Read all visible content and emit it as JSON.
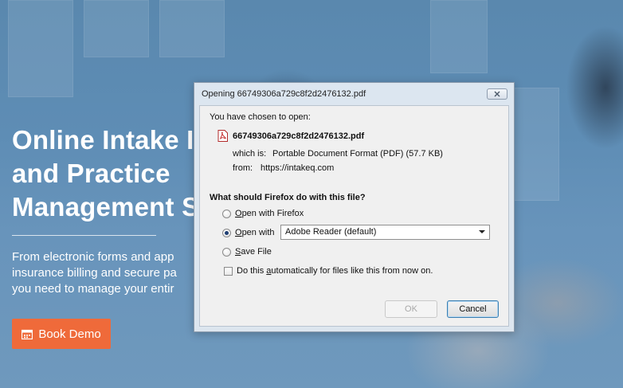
{
  "hero": {
    "headline": "Online Intake I\nand Practice\nManagement S",
    "subtext": "From electronic forms and app\ninsurance billing and secure pa\nyou need to manage your entir",
    "demo_button": "Book Demo",
    "demo_button_icon": "calendar-icon",
    "accent_color": "#ef6a3a"
  },
  "dialog": {
    "title": "Opening 66749306a729c8f2d2476132.pdf",
    "intro": "You have chosen to open:",
    "file_name": "66749306a729c8f2d2476132.pdf",
    "file_icon": "pdf-icon",
    "which_is_label": "which is:",
    "which_is_value": "Portable Document Format (PDF) (57.7 KB)",
    "from_label": "from:",
    "from_value": "https://intakeq.com",
    "question": "What should Firefox do with this file?",
    "options": {
      "open_with_firefox": "Open with Firefox",
      "open_with": "Open with",
      "save_file": "Save File"
    },
    "selected_option": "open_with",
    "app_select_value": "Adobe Reader  (default)",
    "auto_checkbox_label": "Do this automatically for files like this from now on.",
    "auto_checkbox_checked": false,
    "ok_label": "OK",
    "cancel_label": "Cancel",
    "close_icon": "close-icon"
  }
}
